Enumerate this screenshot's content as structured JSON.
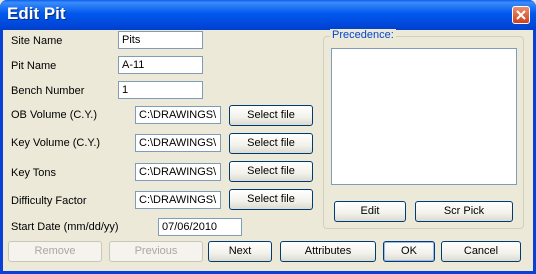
{
  "window": {
    "title": "Edit Pit"
  },
  "fields": {
    "site_name": {
      "label": "Site Name",
      "value": "Pits"
    },
    "pit_name": {
      "label": "Pit Name",
      "value": "A-11"
    },
    "bench_number": {
      "label": "Bench Number",
      "value": "1"
    },
    "ob_volume": {
      "label": "OB Volume (C.Y.)",
      "value": "C:\\DRAWINGS\\",
      "button": "Select file"
    },
    "key_volume": {
      "label": "Key Volume (C.Y.)",
      "value": "C:\\DRAWINGS\\",
      "button": "Select file"
    },
    "key_tons": {
      "label": "Key Tons",
      "value": "C:\\DRAWINGS\\",
      "button": "Select file"
    },
    "difficulty_factor": {
      "label": "Difficulty Factor",
      "value": "C:\\DRAWINGS\\",
      "button": "Select file"
    },
    "start_date": {
      "label": "Start Date (mm/dd/yy)",
      "value": "07/06/2010"
    }
  },
  "precedence": {
    "title": "Precedence:",
    "edit": "Edit",
    "scr_pick": "Scr Pick"
  },
  "footer": {
    "remove": "Remove",
    "previous": "Previous",
    "next": "Next",
    "attributes": "Attributes",
    "ok": "OK",
    "cancel": "Cancel"
  },
  "icons": {
    "close": "close-icon"
  },
  "colors": {
    "title_bar": "#0058ee",
    "close_button": "#d0401a",
    "group_title": "#0046d5"
  }
}
